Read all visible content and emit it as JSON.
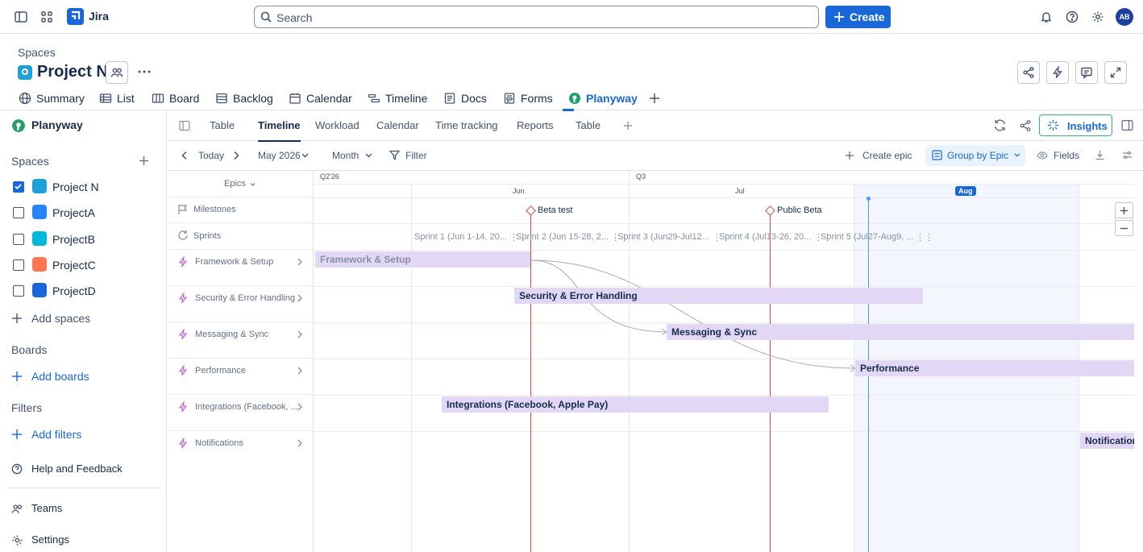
{
  "topbar": {
    "app_name": "Jira",
    "search_placeholder": "Search",
    "create_label": "Create",
    "avatar_initials": "AB"
  },
  "project": {
    "breadcrumb": "Spaces",
    "title": "Project N"
  },
  "project_tabs": [
    "Summary",
    "List",
    "Board",
    "Backlog",
    "Calendar",
    "Timeline",
    "Docs",
    "Forms",
    "Planyway"
  ],
  "sidebar": {
    "brand": "Planyway",
    "spaces_heading": "Spaces",
    "spaces": [
      {
        "label": "Project N",
        "checked": true,
        "color": "#1ea1d8"
      },
      {
        "label": "ProjectA",
        "checked": false,
        "color": "#2684ff"
      },
      {
        "label": "ProjectB",
        "checked": false,
        "color": "#00b8d9"
      },
      {
        "label": "ProjectC",
        "checked": false,
        "color": "#ff7452"
      },
      {
        "label": "ProjectD",
        "checked": false,
        "color": "#1868db"
      }
    ],
    "add_spaces": "Add spaces",
    "boards_heading": "Boards",
    "add_boards": "Add boards",
    "filters_heading": "Filters",
    "add_filters": "Add filters",
    "help": "Help and Feedback",
    "teams": "Teams",
    "settings": "Settings"
  },
  "planyway_tabs": [
    "Table",
    "Timeline",
    "Workload",
    "Calendar",
    "Time tracking",
    "Reports",
    "Table"
  ],
  "insights_label": "Insights",
  "toolbar": {
    "today": "Today",
    "period": "May 2026",
    "scale": "Month",
    "filter": "Filter",
    "create_epic": "Create epic",
    "group_by": "Group by Epic",
    "fields": "Fields"
  },
  "timeline": {
    "epics_header": "Epics",
    "quarters": [
      "Q2'26",
      "Q3"
    ],
    "months": [
      "Jun",
      "Jul",
      "Aug"
    ],
    "rows": [
      "Milestones",
      "Sprints",
      "Framework & Setup",
      "Security & Error Handling",
      "Messaging & Sync",
      "Performance",
      "Integrations (Facebook, ...",
      "Notifications"
    ],
    "milestones": [
      "Beta test",
      "Public Beta"
    ],
    "sprints": [
      "Sprint 1 (Jun 1-14, 20...",
      "Sprint 2 (Jun 15-28, 2...",
      "Sprint 3 (Jun29-Jul12...",
      "Sprint 4 (Jul13-26, 20...",
      "Sprint 5 (Jul27-Aug9, ..."
    ],
    "bars": [
      "Framework & Setup",
      "Security & Error Handling",
      "Messaging & Sync",
      "Performance",
      "Integrations (Facebook, Apple Pay)",
      "Notification"
    ]
  },
  "colors": {
    "accent": "#1868db",
    "bar": "#e2d7f5",
    "milestone": "#e2483d",
    "today": "#4c9aff"
  }
}
